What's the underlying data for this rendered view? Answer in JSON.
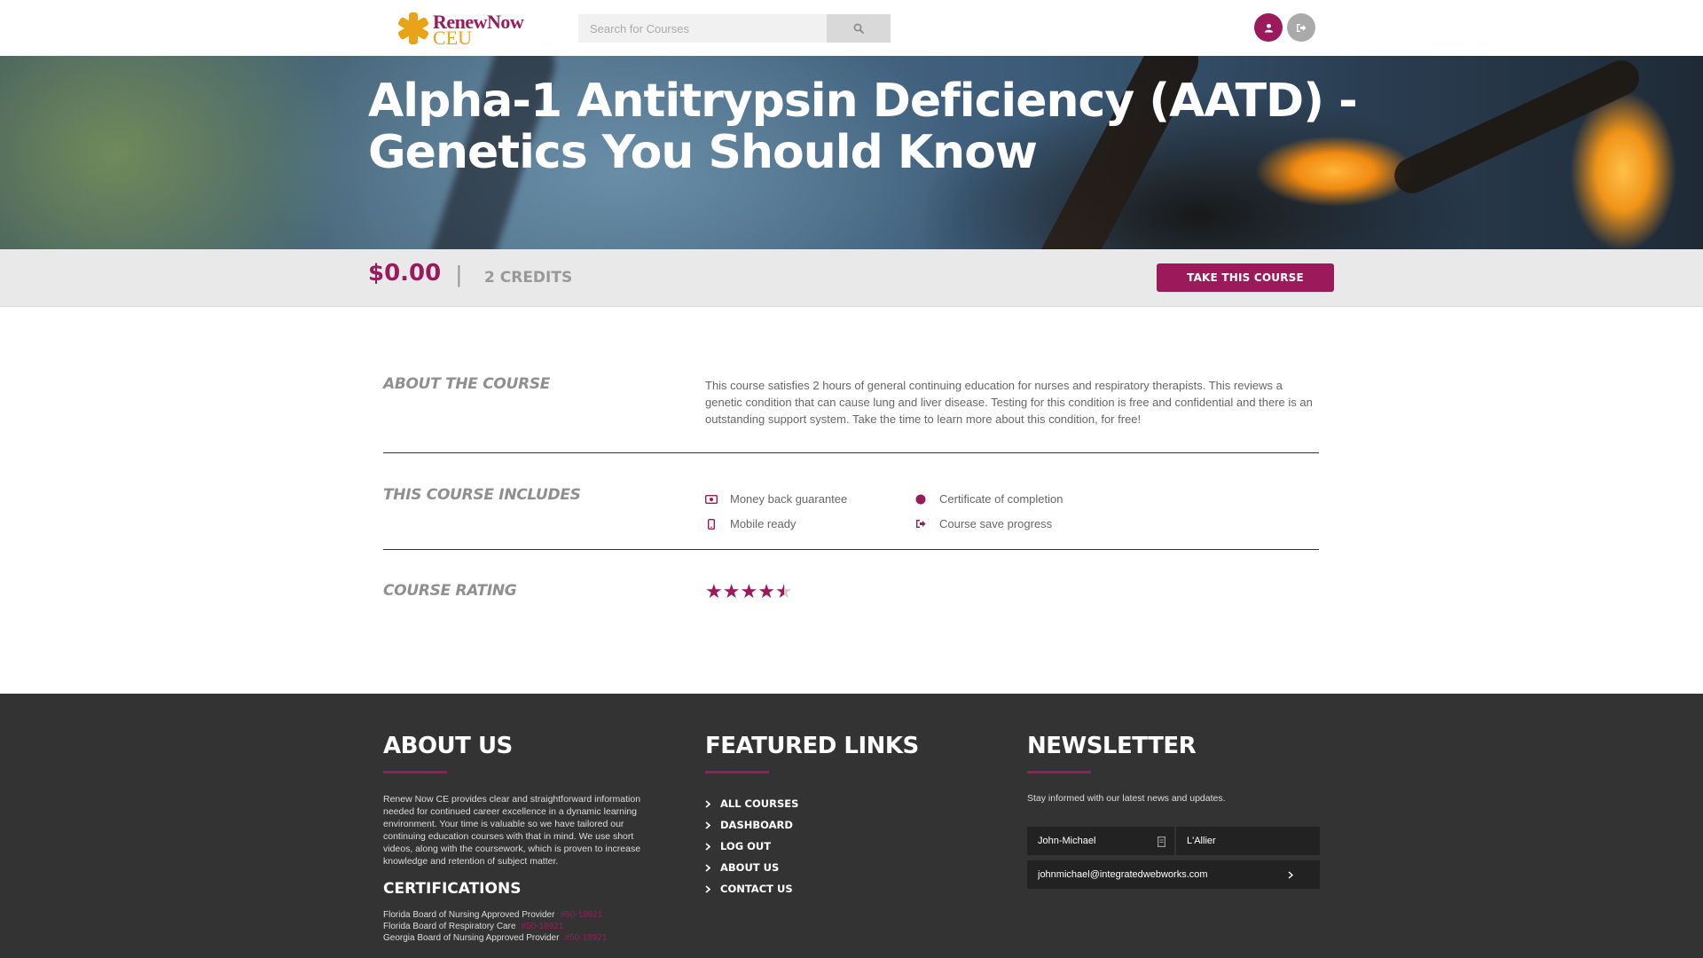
{
  "header": {
    "logo_line1": "RenewNow",
    "logo_line2": "CEU",
    "search_placeholder": "Search for Courses"
  },
  "hero": {
    "title": "Alpha-1 Antitrypsin Deficiency (AATD) - Genetics You Should Know"
  },
  "pricebar": {
    "price": "$0.00",
    "separator": "|",
    "credits": "2 CREDITS",
    "take_course_label": "TAKE THIS COURSE"
  },
  "about_course": {
    "heading": "ABOUT THE COURSE",
    "text": "This course satisfies 2 hours of general continuing education for nurses and respiratory therapists.  This reviews a genetic condition that can cause lung and liver disease.  Testing for this condition is free and confidential and there is an outstanding support system.  Take the time to learn more about this condition, for free!"
  },
  "includes": {
    "heading": "THIS COURSE INCLUDES",
    "items": [
      {
        "label": "Money back guarantee",
        "icon": "money-icon"
      },
      {
        "label": "Certificate of completion",
        "icon": "certificate-icon"
      },
      {
        "label": "Mobile ready",
        "icon": "mobile-icon"
      },
      {
        "label": "Course save progress",
        "icon": "save-progress-icon"
      }
    ]
  },
  "rating": {
    "heading": "COURSE RATING",
    "value": 4.5,
    "max": 5
  },
  "footer": {
    "about": {
      "heading": "ABOUT US",
      "text": "Renew Now CE provides clear and straightforward information needed for continued career excellence in a dynamic learning environment. Your time is valuable so we have tailored our continuing education courses with that in mind. We use short videos, along with the coursework, which is proven to increase knowledge and retention of subject matter."
    },
    "certifications": {
      "heading": "CERTIFICATIONS",
      "items": [
        {
          "label": "Florida Board of Nursing Approved Provider",
          "number": "#50-18921"
        },
        {
          "label": "Florida Board of Respiratory Care",
          "number": "#50-18921"
        },
        {
          "label": "Georgia Board of Nursing Approved Provider",
          "number": "#50-18921"
        }
      ]
    },
    "featured": {
      "heading": "FEATURED LINKS",
      "links": [
        "ALL COURSES",
        "DASHBOARD",
        "LOG OUT",
        "ABOUT US",
        "CONTACT US"
      ]
    },
    "newsletter": {
      "heading": "NEWSLETTER",
      "text": "Stay informed with our latest news and updates.",
      "first_name": "John-Michael",
      "last_name": "L'Allier",
      "email": "johnmichael@integratedwebworks.com"
    }
  },
  "colors": {
    "accent": "#9b1a5c",
    "logo_gold": "#e8a317",
    "footer_bg": "#333333"
  }
}
